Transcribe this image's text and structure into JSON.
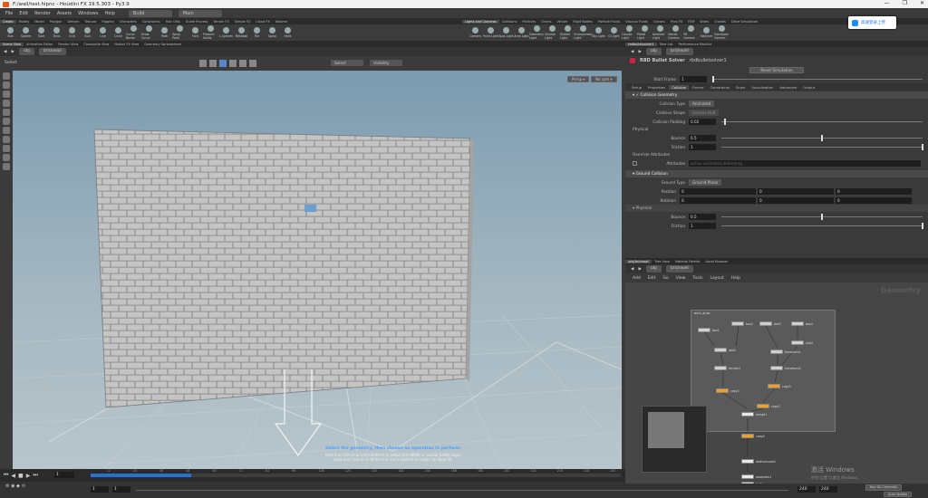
{
  "window": {
    "title": "F:/wall/test.hipnc - Houdini FX 19.5.303 - Py3.9",
    "controls": [
      "—",
      "❐",
      "✕"
    ]
  },
  "menubar": {
    "items": [
      "File",
      "Edit",
      "Render",
      "Assets",
      "Windows",
      "Help"
    ],
    "desktop": "Build",
    "context": "Main"
  },
  "shelf_tabs_left": [
    "Create",
    "Modify",
    "Model",
    "Polygon",
    "Deform",
    "Texture",
    "Rigging",
    "Characters",
    "Constraints",
    "Hair Utils",
    "Guide Process",
    "Terrain FX",
    "Simple FX",
    "Cloud FX",
    "Volume"
  ],
  "shelf_tabs_right": [
    "Lights and Cameras",
    "Collisions",
    "Particles",
    "Grains",
    "Vellum",
    "Rigid Bodies",
    "Particle Fluids",
    "Viscous Fluids",
    "Oceans",
    "Pyro FX",
    "FEM",
    "Wires",
    "Crowds",
    "Drive Simulation"
  ],
  "shelf_tools_left": [
    "Box",
    "Sphere",
    "Tube",
    "Torus",
    "Grid",
    "Null",
    "Line",
    "Circle",
    "Curve Bezier",
    "Draw Curve",
    "Path",
    "Spray Paint",
    "Font",
    "Platonic Solids",
    "L-System",
    "Metaball",
    "File",
    "Spiral",
    "Helix"
  ],
  "shelf_tools_right": [
    "Camera",
    "Point Light",
    "Spot Light",
    "Area Light",
    "Geometry Light",
    "Volume Light",
    "Distant Light",
    "Environment Light",
    "Sky Light",
    "GI Light",
    "Caustic Light",
    "Portal Light",
    "Ambient Light",
    "Stereo Camera",
    "VR Camera",
    "Switcher",
    "Gamepad Camera"
  ],
  "notify": {
    "label": "高速登录上传"
  },
  "scene_tabs": [
    "Scene View",
    "Animation Editor",
    "Render View",
    "Composite View",
    "Motion FX View",
    "Geometry Spreadsheet"
  ],
  "scene_path": {
    "root": "obj",
    "node": "brickwall"
  },
  "viewport_toolbar": {
    "tool_label": "Select",
    "select_mode": "Select",
    "visibility": "Visibility",
    "persp": "Persp ▾",
    "cam": "No cam ▾"
  },
  "status": {
    "primary": "Select the geometry, then choose an operation to perform.",
    "line2": "Hold A or Ctrl+A or Ctrl+Shift+A to select full (MMB) or partial (LMB) loops.",
    "line3": "Hold H or Ctrl+H or Shift+H or Ctrl+Shift+H to select by flood fill."
  },
  "timeline": {
    "current_frame": "1",
    "ticks": [
      "12",
      "24",
      "36",
      "48",
      "60",
      "72",
      "84",
      "96",
      "108",
      "120",
      "132",
      "144",
      "156",
      "168",
      "180",
      "192",
      "204",
      "216",
      "228",
      "240"
    ],
    "playback_fraction": 0.19
  },
  "bottombar": {
    "start": "1",
    "start2": "1",
    "end": "240",
    "end2": "240",
    "keys": "0 keys, 0/0 channels",
    "key_all": "Key All Channels",
    "auto_update": "Auto Update"
  },
  "param_tabs": [
    "rbdbulletsolver1",
    "Take List",
    "Performance Monitor"
  ],
  "param_path": {
    "root": "obj",
    "node": "brickwall"
  },
  "solver": {
    "type": "RBD Bullet Solver",
    "name": "rbdbulletsolver1",
    "reset_label": "Reset Simulation",
    "start_frame_label": "Start Frame",
    "start_frame": "1",
    "tabs": [
      "Setup",
      "Properties",
      "Collision",
      "Forces",
      "Constraints",
      "Scale",
      "Visualization",
      "Advanced",
      "Output"
    ],
    "active_tab": "Collision"
  },
  "collision_geometry": {
    "title": "Collision Geometry",
    "type_label": "Collision Type",
    "type": "Animated",
    "shape_label": "Collision Shape",
    "shape": "Convex Hull",
    "padding_label": "Collision Padding",
    "padding": "0.02",
    "padding_fraction": 0.02,
    "physical": "Physical",
    "bounce_label": "Bounce",
    "bounce": "0.5",
    "bounce_fraction": 0.5,
    "friction_label": "Friction",
    "friction": "1",
    "friction_fraction": 1,
    "override": "Override Attributes",
    "attributes_label": "Attributes",
    "attributes": "active animated deforming"
  },
  "ground_collision": {
    "title": "Ground Collision",
    "type_label": "Ground Type",
    "type": "Ground Plane",
    "position_label": "Position",
    "position": [
      "0",
      "0",
      "0"
    ],
    "rotation_label": "Rotation",
    "rotation": [
      "0",
      "0",
      "0"
    ],
    "physical": "Physical",
    "bounce_label": "Bounce",
    "bounce": "0.5",
    "bounce_fraction": 0.5,
    "friction_label": "Friction",
    "friction": "1",
    "friction_fraction": 1
  },
  "net_tabs": [
    "/obj/brickwall",
    "Tree View",
    "Material Palette",
    "Asset Browser"
  ],
  "net_path": {
    "root": "obj",
    "node": "brickwall"
  },
  "net_menu": [
    "Add",
    "Edit",
    "Go",
    "View",
    "Tools",
    "Layout",
    "Help"
  ],
  "network": {
    "context_label": "Geometry",
    "box_label": "brick_draw",
    "nodes": [
      {
        "label": "box1"
      },
      {
        "label": "box2"
      },
      {
        "label": "box3"
      },
      {
        "label": "box4"
      },
      {
        "label": "add1"
      },
      {
        "label": "add2"
      },
      {
        "label": "bricker1"
      },
      {
        "label": "transform1"
      },
      {
        "label": "transform2"
      },
      {
        "label": "copy1"
      },
      {
        "label": "copy2"
      },
      {
        "label": "copy3"
      },
      {
        "label": "merge1"
      },
      {
        "label": "copy4"
      },
      {
        "label": "rbdfractured1"
      },
      {
        "label": "assemble1"
      },
      {
        "label": "OUT"
      }
    ]
  },
  "watermark": {
    "line1": "激活 Windows",
    "line2": "转到\"设置\"以激活 Windows。"
  }
}
